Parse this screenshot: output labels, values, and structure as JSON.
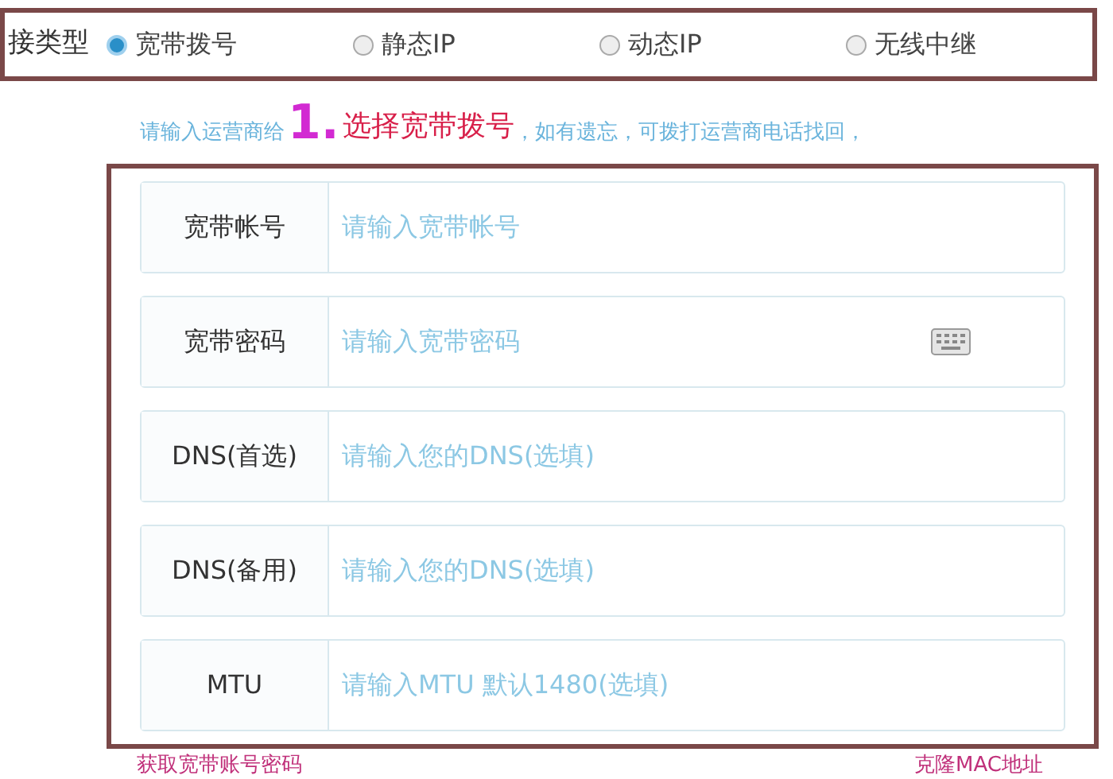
{
  "connection_type": {
    "label": "接类型",
    "options": [
      {
        "label": "宽带拨号",
        "selected": true
      },
      {
        "label": "静态IP",
        "selected": false
      },
      {
        "label": "动态IP",
        "selected": false
      },
      {
        "label": "无线中继",
        "selected": false
      }
    ]
  },
  "hint": {
    "before": "请输入运营商给",
    "after": "，如有遗忘，可拨打运营商电话找回，"
  },
  "annotation": {
    "number": "1.",
    "text": "选择宽带拨号"
  },
  "fields": [
    {
      "kind": "text",
      "label": "宽带帐号",
      "placeholder": "请输入宽带帐号"
    },
    {
      "kind": "password",
      "label": "宽带密码",
      "placeholder": "请输入宽带密码"
    },
    {
      "kind": "text",
      "label": "DNS(首选)",
      "placeholder": "请输入您的DNS(选填)"
    },
    {
      "kind": "text",
      "label": "DNS(备用)",
      "placeholder": "请输入您的DNS(选填)"
    },
    {
      "kind": "text",
      "label": "MTU",
      "placeholder": "请输入MTU 默认1480(选填)"
    }
  ],
  "links": [
    "获取宽带账号密码",
    "克隆MAC地址"
  ]
}
